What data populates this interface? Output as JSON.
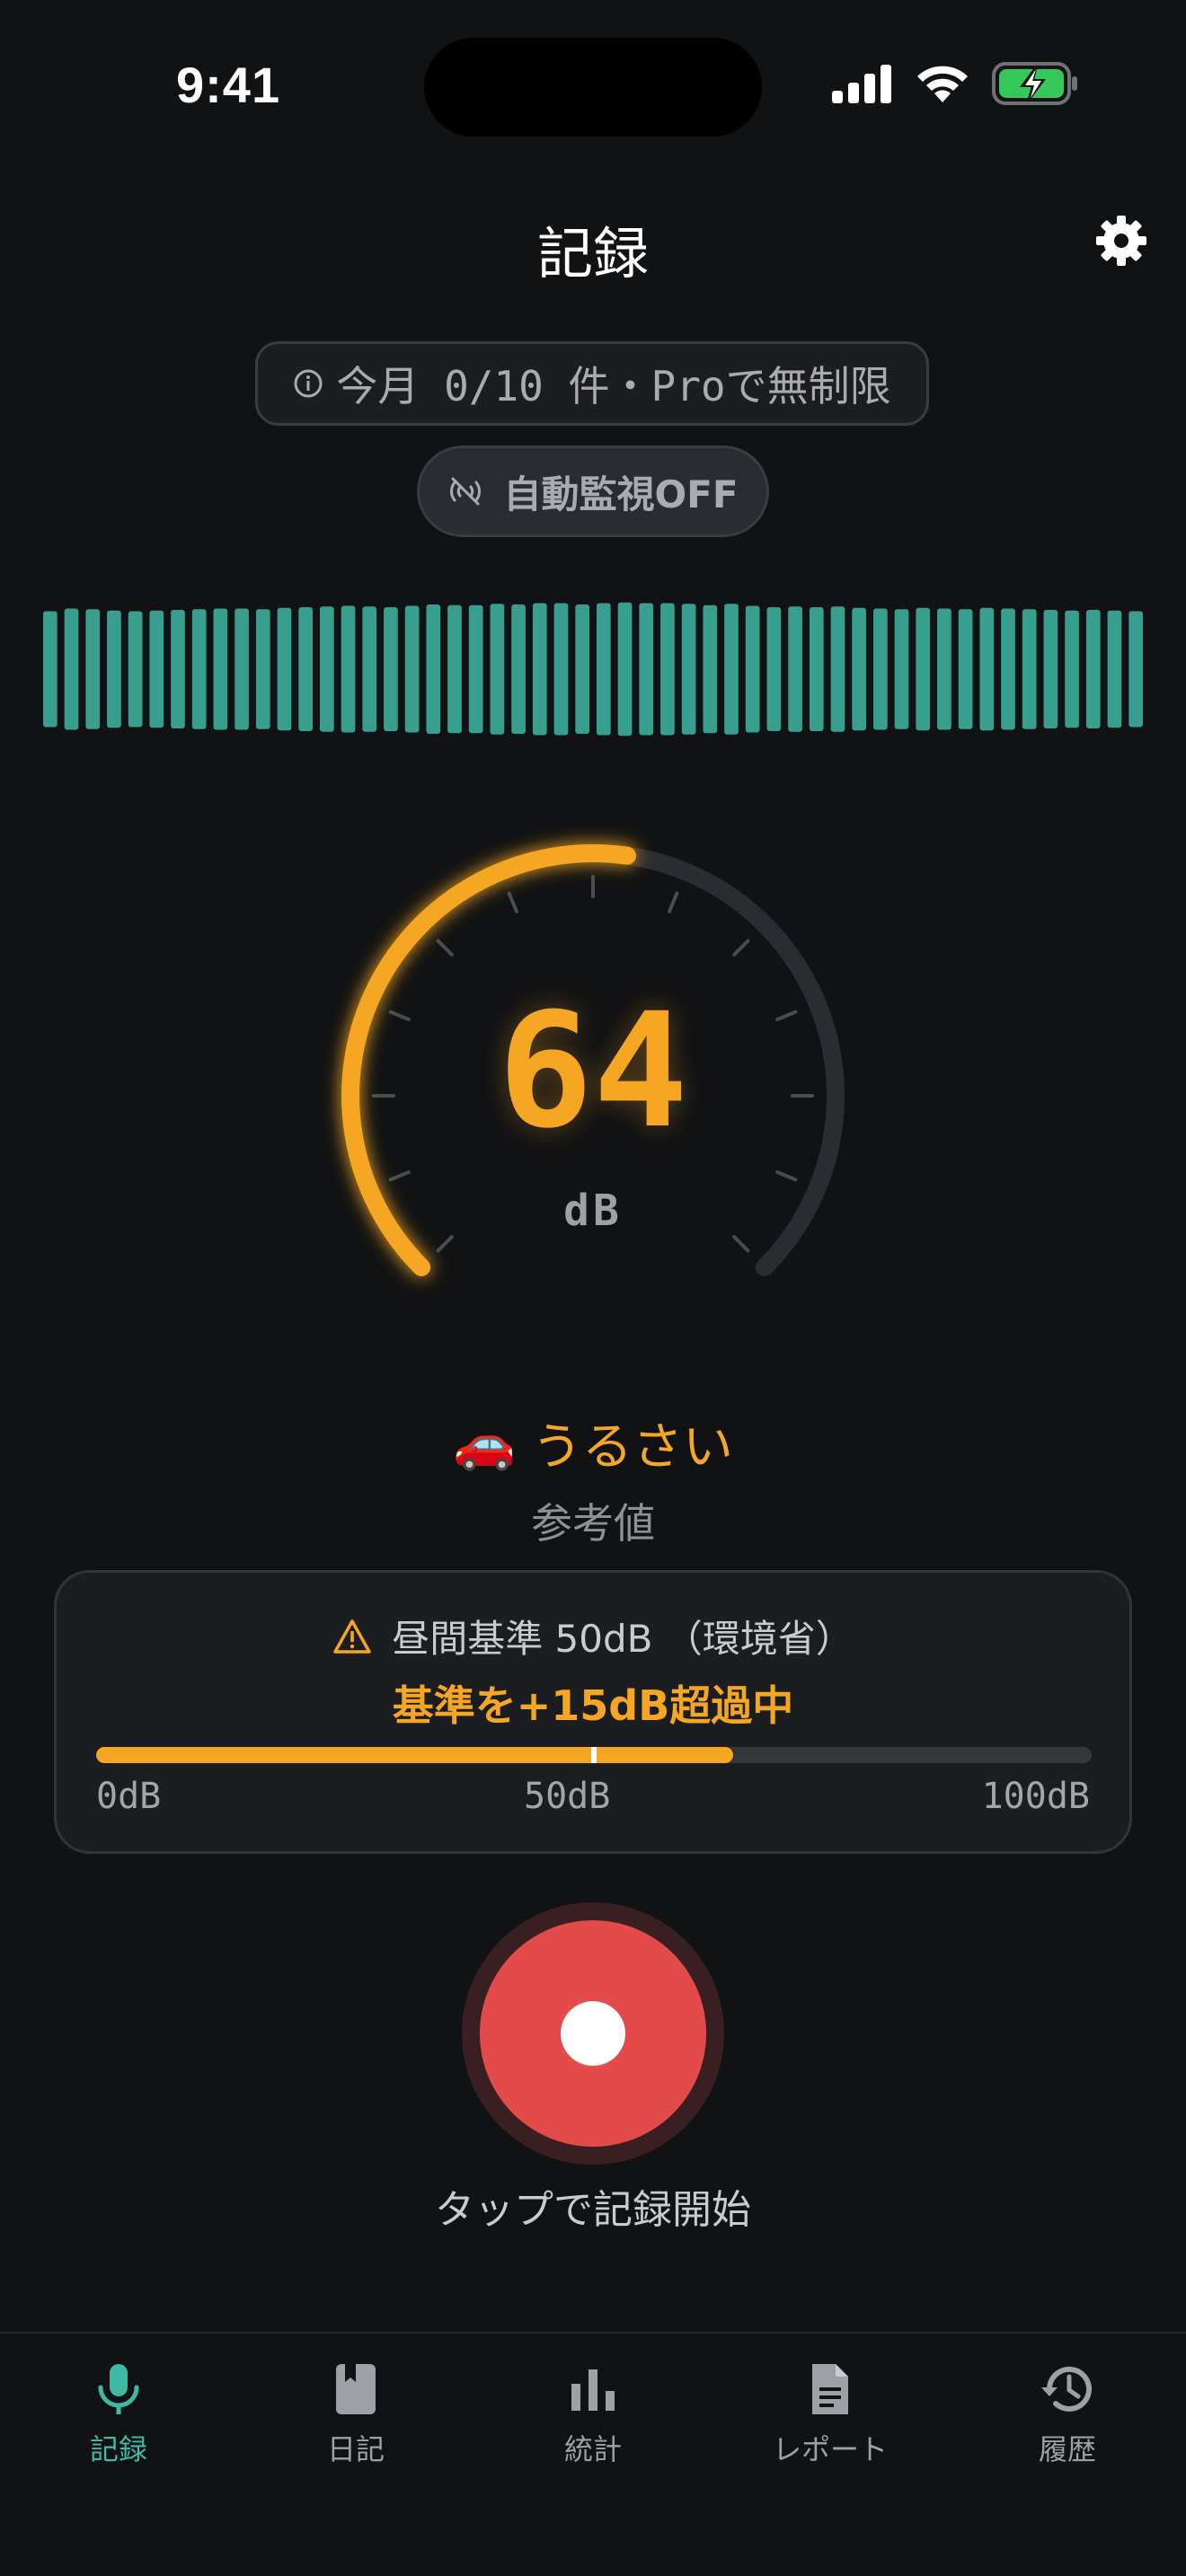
{
  "status_bar": {
    "time": "9:41"
  },
  "header": {
    "title": "記録"
  },
  "quota": {
    "text": "今月 0/10 件・Proで無制限"
  },
  "auto_monitor": {
    "text": "自動監視OFF"
  },
  "meter": {
    "value": "64",
    "unit": "dB",
    "level": "うるさい",
    "level_emoji": "🚗",
    "note": "参考値",
    "gauge_max_db": 120,
    "gauge_fraction": 0.53
  },
  "standard": {
    "title": "昼間基準 50dB （環境省）",
    "exceed": "基準を+15dB超過中",
    "scale_min": "0dB",
    "scale_mid": "50dB",
    "scale_max": "100dB",
    "current_db": 64,
    "threshold_db": 50,
    "max_db": 100
  },
  "record": {
    "hint": "タップで記録開始"
  },
  "tabs": [
    {
      "label": "記録",
      "icon": "mic-icon",
      "active": true
    },
    {
      "label": "日記",
      "icon": "book-icon",
      "active": false
    },
    {
      "label": "統計",
      "icon": "bar-chart-icon",
      "active": false
    },
    {
      "label": "レポート",
      "icon": "document-icon",
      "active": false
    },
    {
      "label": "履歴",
      "icon": "history-icon",
      "active": false
    }
  ],
  "colors": {
    "accent": "#f5a623",
    "teal": "#3fb9a4",
    "record": "#e34a4a",
    "background": "#111214"
  },
  "waveform_levels": [
    0.86,
    0.9,
    0.89,
    0.87,
    0.86,
    0.87,
    0.88,
    0.89,
    0.9,
    0.9,
    0.89,
    0.91,
    0.92,
    0.93,
    0.94,
    0.93,
    0.92,
    0.94,
    0.96,
    0.95,
    0.95,
    0.97,
    0.96,
    0.98,
    0.98,
    0.96,
    0.98,
    0.99,
    0.98,
    0.98,
    0.97,
    0.95,
    0.97,
    0.94,
    0.92,
    0.93,
    0.92,
    0.93,
    0.91,
    0.9,
    0.89,
    0.91,
    0.9,
    0.89,
    0.91,
    0.9,
    0.89,
    0.88,
    0.87,
    0.88,
    0.87,
    0.86
  ]
}
